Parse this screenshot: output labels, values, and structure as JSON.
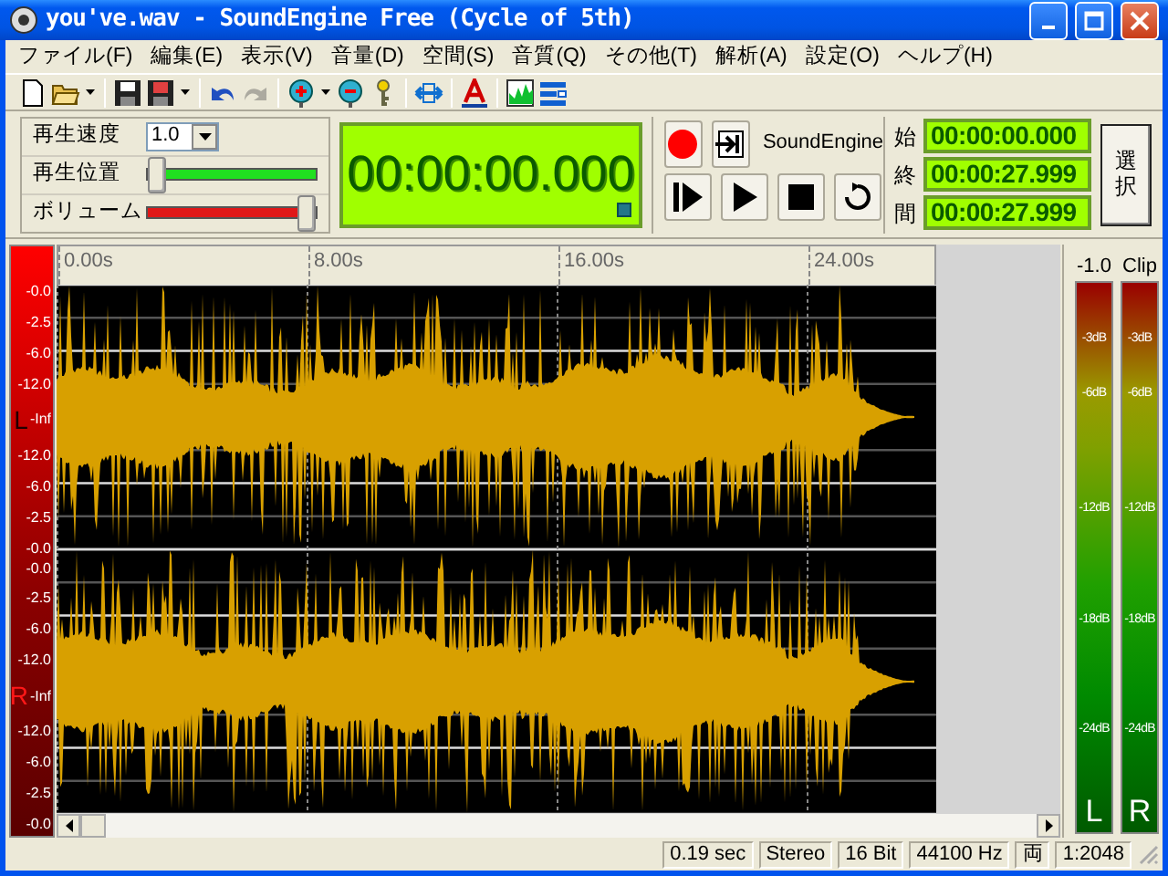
{
  "window": {
    "title": "you've.wav - SoundEngine Free (Cycle of 5th)"
  },
  "menu": [
    {
      "label": "ファイル(F)"
    },
    {
      "label": "編集(E)"
    },
    {
      "label": "表示(V)"
    },
    {
      "label": "音量(D)"
    },
    {
      "label": "空間(S)"
    },
    {
      "label": "音質(Q)"
    },
    {
      "label": "その他(T)"
    },
    {
      "label": "解析(A)"
    },
    {
      "label": "設定(O)"
    },
    {
      "label": "ヘルプ(H)"
    }
  ],
  "toolbar": [
    {
      "items": [
        {
          "kind": "new",
          "disabled": false
        },
        {
          "kind": "open",
          "disabled": false
        },
        {
          "kind": "caret",
          "disabled": false
        }
      ]
    },
    {
      "items": [
        {
          "kind": "save",
          "disabled": false
        },
        {
          "kind": "saveas",
          "disabled": false
        },
        {
          "kind": "caret",
          "disabled": false
        }
      ]
    },
    {
      "items": [
        {
          "kind": "undo",
          "disabled": false
        },
        {
          "kind": "redo",
          "disabled": true
        }
      ]
    },
    {
      "items": [
        {
          "kind": "zoomin",
          "disabled": false
        },
        {
          "kind": "caret",
          "disabled": false
        },
        {
          "kind": "zoomout",
          "disabled": false
        },
        {
          "kind": "key",
          "disabled": false
        }
      ]
    },
    {
      "items": [
        {
          "kind": "fit",
          "disabled": false
        }
      ]
    },
    {
      "items": [
        {
          "kind": "letter",
          "disabled": false
        }
      ]
    },
    {
      "items": [
        {
          "kind": "spectrum",
          "disabled": false
        },
        {
          "kind": "layout",
          "disabled": false
        }
      ]
    }
  ],
  "controls": {
    "speed": {
      "label": "再生速度",
      "value": "1.0"
    },
    "position": {
      "label": "再生位置",
      "level": 0.0
    },
    "volume": {
      "label": "ボリューム",
      "level": 1.0
    }
  },
  "time_display": {
    "value": "00:00:00.000"
  },
  "transport": {
    "brand": "SoundEngine"
  },
  "range": [
    {
      "label": "始",
      "value": "00:00:00.000"
    },
    {
      "label": "終",
      "value": "00:00:27.999"
    },
    {
      "label": "間",
      "value": "00:00:27.999"
    }
  ],
  "select_button": {
    "label": "選択"
  },
  "ruler": [
    "0.00s",
    "8.00s",
    "16.00s",
    "24.00s"
  ],
  "channels": [
    {
      "letter": "L",
      "scale": [
        "-0.0",
        "-2.5",
        "-6.0",
        "-12.0",
        "-Inf",
        "-12.0",
        "-6.0",
        "-2.5",
        "-0.0"
      ]
    },
    {
      "letter": "R",
      "scale": [
        "-0.0",
        "-2.5",
        "-6.0",
        "-12.0",
        "-Inf",
        "-12.0",
        "-6.0",
        "-2.5",
        "-0.0"
      ]
    }
  ],
  "meters": [
    {
      "header": "-1.0",
      "scale": [
        "-3dB",
        "-6dB",
        "-12dB",
        "-18dB",
        "-24dB"
      ],
      "letter": "L"
    },
    {
      "header": "Clip",
      "scale": [
        "-3dB",
        "-6dB",
        "-12dB",
        "-18dB",
        "-24dB"
      ],
      "letter": "R"
    }
  ],
  "status_bar": [
    "0.19 sec",
    "Stereo",
    "16 Bit",
    "44100 Hz",
    "両",
    "1:2048"
  ]
}
